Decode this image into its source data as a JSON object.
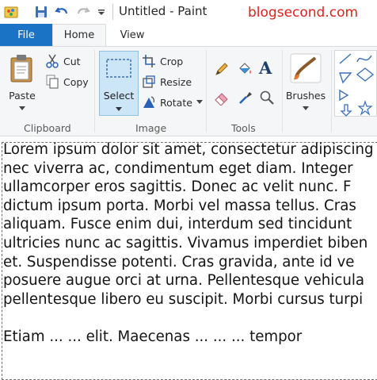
{
  "window": {
    "title": "Untitled - Paint",
    "watermark": "blogsecond.com"
  },
  "tabs": [
    {
      "label": "File"
    },
    {
      "label": "Home"
    },
    {
      "label": "View"
    }
  ],
  "ribbon": {
    "clipboard": {
      "paste_label": "Paste",
      "cut_label": "Cut",
      "copy_label": "Copy",
      "group_label": "Clipboard"
    },
    "image": {
      "select_label": "Select",
      "crop_label": "Crop",
      "resize_label": "Resize",
      "rotate_label": "Rotate",
      "group_label": "Image"
    },
    "tools": {
      "group_label": "Tools"
    },
    "brushes_label": "Brushes"
  },
  "canvas": {
    "lines": [
      "Lorem ipsum dolor sit amet, consectetur adipiscing",
      "nec viverra ac, condimentum eget diam. Integer",
      "ullamcorper eros sagittis. Donec ac velit nunc. F",
      "dictum ipsum porta. Morbi vel massa tellus. Cras",
      "aliquam. Fusce enim dui, interdum sed tincidunt",
      "ultricies nunc ac sagittis. Vivamus imperdiet biben",
      "et. Suspendisse potenti. Cras gravida, ante id ve",
      "posuere augue orci at urna. Pellentesque vehicula",
      "pellentesque libero eu suscipit. Morbi cursus turpi",
      "",
      "Etiam ... ... elit. Maecenas ... ... ... tempor"
    ]
  },
  "colors": {
    "file_tab": "#1a73c5",
    "ribbon_bg": "#f5f6f7",
    "select_highlight": "#cde6f7",
    "watermark": "#e0201f"
  }
}
